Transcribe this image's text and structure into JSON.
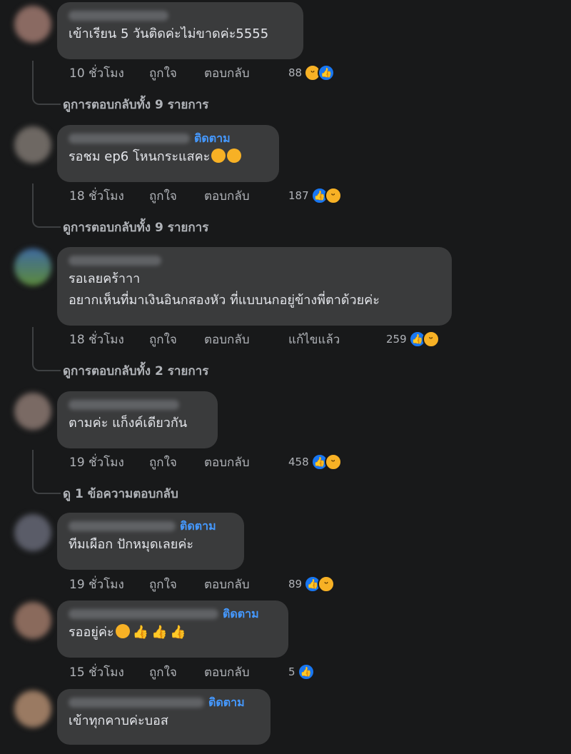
{
  "labels": {
    "like": "ถูกใจ",
    "reply": "ตอบกลับ",
    "follow": "ติดตาม",
    "edited": "แก้ไขแล้ว"
  },
  "comments": [
    {
      "text": "เข้าเรียน 5 วันติดค่ะไม่ขาดค่ะ5555",
      "time": "10 ชั่วโมง",
      "reaction_count": "88",
      "reactions": [
        "haha",
        "like"
      ],
      "view_replies": "ดูการตอบกลับทั้ง 9 รายการ"
    },
    {
      "text": "รอชม ep6 โหนกระแสคะ",
      "time": "18 ชั่วโมง",
      "reaction_count": "187",
      "reactions": [
        "like",
        "haha"
      ],
      "view_replies": "ดูการตอบกลับทั้ง 9 รายการ"
    },
    {
      "text_line1": "รอเลยคร้าาา",
      "text_line2": "อยากเห็นที่มาเงินอินกสองหัว ที่แบบนกอยู่ข้างพี่ตาด้วยค่ะ",
      "time": "18 ชั่วโมง",
      "reaction_count": "259",
      "reactions": [
        "like",
        "haha"
      ],
      "view_replies": "ดูการตอบกลับทั้ง 2 รายการ"
    },
    {
      "text": "ตามค่ะ แก็งค์เดียวกัน",
      "time": "19 ชั่วโมง",
      "reaction_count": "458",
      "reactions": [
        "like",
        "haha"
      ],
      "view_replies": "ดู 1 ข้อความตอบกลับ"
    },
    {
      "text": "ทีมเผือก ปักหมุดเลยค่ะ",
      "time": "19 ชั่วโมง",
      "reaction_count": "89",
      "reactions": [
        "like",
        "haha"
      ]
    },
    {
      "text": "รออยู่ค่ะ",
      "time": "15 ชั่วโมง",
      "reaction_count": "5",
      "reactions": [
        "like"
      ]
    },
    {
      "text": "เข้าทุกคาบค่ะบอส"
    }
  ],
  "colors": {
    "background": "#18191a",
    "bubble": "#3a3b3c",
    "link": "#4599ff",
    "like": "#1877f2",
    "haha": "#f7b125"
  }
}
